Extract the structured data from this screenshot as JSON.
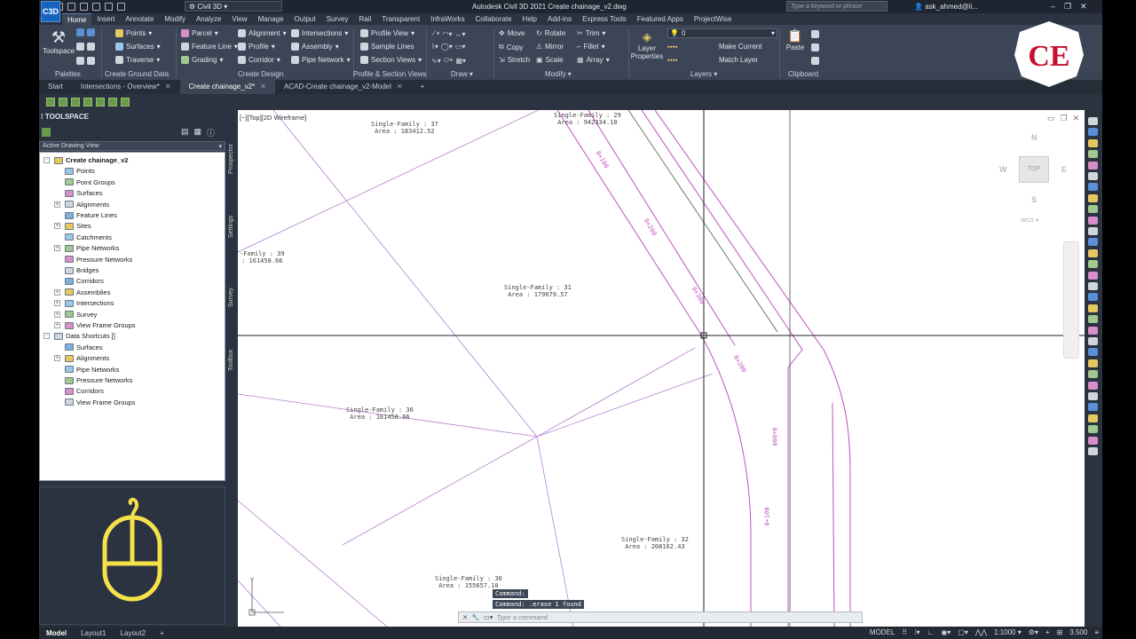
{
  "app": {
    "title": "Autodesk Civil 3D 2021    Create chainage_v2.dwg",
    "workspace": "Civil 3D",
    "search_placeholder": "Type a keyword or phrase",
    "user": "ask_ahmed@li..."
  },
  "menu_tabs": [
    "Home",
    "Insert",
    "Annotate",
    "Modify",
    "Analyze",
    "View",
    "Manage",
    "Output",
    "Survey",
    "Rail",
    "Transparent",
    "InfraWorks",
    "Collaborate",
    "Help",
    "Add-ins",
    "Express Tools",
    "Featured Apps",
    "ProjectWise"
  ],
  "ribbon": {
    "palettes": {
      "big_label": "Toolspace",
      "group": "Palettes"
    },
    "ground": {
      "items": [
        "Points",
        "Surfaces",
        "Traverse"
      ],
      "group": "Create Ground Data"
    },
    "design": {
      "items": [
        "Parcel",
        "Feature Line",
        "Grading",
        "Alignment",
        "Profile",
        "Corridor",
        "Intersections",
        "Assembly",
        "Pipe Network"
      ],
      "group": "Create Design"
    },
    "profile": {
      "items": [
        "Profile View",
        "Sample Lines",
        "Section Views"
      ],
      "group": "Profile & Section Views"
    },
    "draw": {
      "group": "Draw"
    },
    "modify": {
      "items": [
        "Move",
        "Copy",
        "Stretch",
        "Rotate",
        "Mirror",
        "Scale",
        "Trim",
        "Fillet",
        "Array"
      ],
      "group": "Modify"
    },
    "layers": {
      "big_label": "Layer Properties",
      "layer_value": "0",
      "items": [
        "Make Current",
        "Match Layer"
      ],
      "group": "Layers"
    },
    "clipboard": {
      "big_label": "Paste",
      "group": "Clipboard"
    }
  },
  "doc_tabs": [
    {
      "label": "Start",
      "active": false,
      "closable": false
    },
    {
      "label": "Intersections - Overview*",
      "active": false,
      "closable": true
    },
    {
      "label": "Create chainage_v2*",
      "active": true,
      "closable": true
    },
    {
      "label": "ACAD-Create chainage_v2-Model",
      "active": false,
      "closable": true
    }
  ],
  "toolspace": {
    "title": "TOOLSPACE",
    "view": "Active Drawing View",
    "vertical_tabs": [
      "Prospector",
      "Settings",
      "Survey",
      "Toolbox"
    ],
    "tree": [
      {
        "label": "Create chainage_v2",
        "level": 0,
        "bold": true,
        "expander": "-"
      },
      {
        "label": "Points",
        "level": 1
      },
      {
        "label": "Point Groups",
        "level": 1
      },
      {
        "label": "Surfaces",
        "level": 1
      },
      {
        "label": "Alignments",
        "level": 1,
        "expander": "+"
      },
      {
        "label": "Feature Lines",
        "level": 1
      },
      {
        "label": "Sites",
        "level": 1,
        "expander": "+"
      },
      {
        "label": "Catchments",
        "level": 1
      },
      {
        "label": "Pipe Networks",
        "level": 1,
        "expander": "+"
      },
      {
        "label": "Pressure Networks",
        "level": 1
      },
      {
        "label": "Bridges",
        "level": 1
      },
      {
        "label": "Corridors",
        "level": 1
      },
      {
        "label": "Assemblies",
        "level": 1,
        "expander": "+"
      },
      {
        "label": "Intersections",
        "level": 1,
        "expander": "+"
      },
      {
        "label": "Survey",
        "level": 1,
        "expander": "+"
      },
      {
        "label": "View Frame Groups",
        "level": 1,
        "expander": "+"
      },
      {
        "label": "Data Shortcuts []",
        "level": 0,
        "expander": "-"
      },
      {
        "label": "Surfaces",
        "level": 1
      },
      {
        "label": "Alignments",
        "level": 1,
        "expander": "+"
      },
      {
        "label": "Pipe Networks",
        "level": 1
      },
      {
        "label": "Pressure Networks",
        "level": 1
      },
      {
        "label": "Corridors",
        "level": 1
      },
      {
        "label": "View Frame Groups",
        "level": 1
      }
    ]
  },
  "viewport": {
    "label": "[−][Top][2D Wireframe]",
    "viewcube": {
      "n": "N",
      "s": "S",
      "e": "E",
      "w": "W",
      "top": "TOP",
      "wcs": "WCS"
    },
    "lots": [
      {
        "name": "Single-Family : 37",
        "area": "Area : 183412.52"
      },
      {
        "name": "Single-Family : 29",
        "area": "Area : 942334.10"
      },
      {
        "name": "-Family : 39",
        "area": ": 161458.66"
      },
      {
        "name": "Single-Family : 31",
        "area": "Area : 179679.57"
      },
      {
        "name": "Single-Family : 36",
        "area": "Area : 161458.66"
      },
      {
        "name": "Single-Family : 32",
        "area": "Area : 208162.43"
      },
      {
        "name": "Single-Family : 30",
        "area": "Area : 155657.10"
      }
    ],
    "stations": [
      "0+100",
      "0+200",
      "0+300",
      "0+200",
      "0+100",
      "0+000"
    ],
    "ucs_y": "Y"
  },
  "command": {
    "history": [
      "Command:",
      "Command: .erase 1 found"
    ],
    "placeholder": "Type a command"
  },
  "status": {
    "tabs": [
      "Model",
      "Layout1",
      "Layout2"
    ],
    "mode": "MODEL",
    "scale": "1:1000",
    "annotation": "3.500"
  },
  "logo": {
    "text": "CE",
    "color": "#c8102e"
  },
  "colors": {
    "alignment": "#c050c0",
    "parcel": "#b070c8",
    "accent": "#3a7bd5"
  }
}
